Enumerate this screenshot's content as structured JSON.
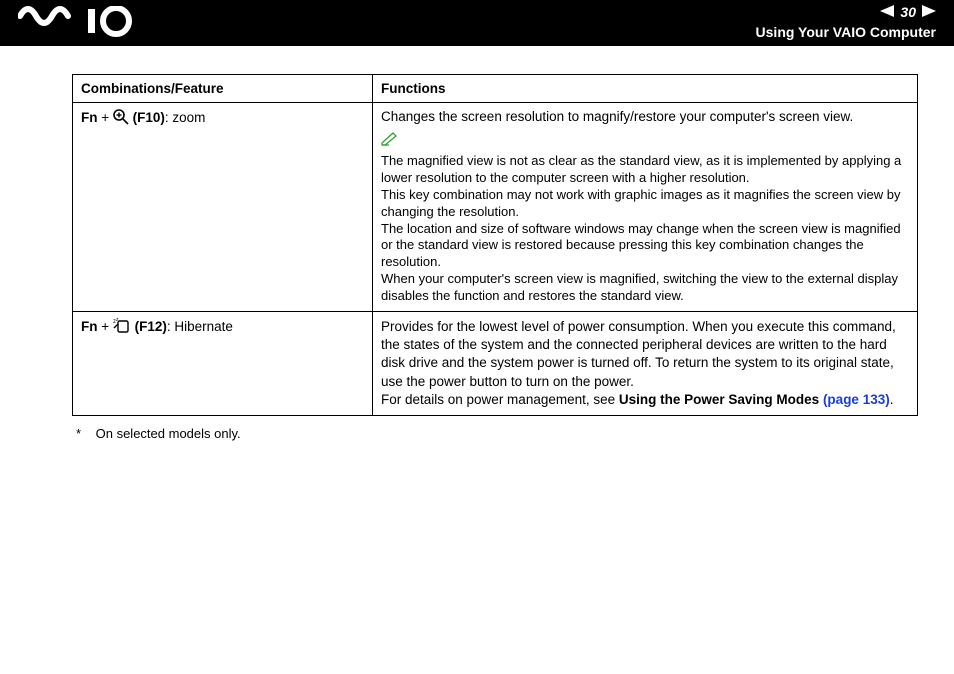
{
  "header": {
    "page_number": "30",
    "section_title": "Using Your VAIO Computer"
  },
  "table": {
    "head": {
      "combo": "Combinations/Feature",
      "func": "Functions"
    },
    "row_zoom": {
      "combo_prefix": "Fn",
      "combo_plus": " + ",
      "combo_key": " (F10)",
      "combo_suffix": ": zoom",
      "desc_main": "Changes the screen resolution to magnify/restore your computer's screen view.",
      "notes": {
        "n1": "The magnified view is not as clear as the standard view, as it is implemented by applying a lower resolution to the computer screen with a higher resolution.",
        "n2": "This key combination may not work with graphic images as it magnifies the screen view by changing the resolution.",
        "n3": "The location and size of software windows may change when the screen view is magnified or the standard view is restored because pressing this key combination changes the resolution.",
        "n4": "When your computer's screen view is magnified, switching the view to the external display disables the function and restores the standard view."
      }
    },
    "row_hib": {
      "combo_prefix": "Fn",
      "combo_plus": " + ",
      "combo_key": " (F12)",
      "combo_suffix": ": Hibernate",
      "desc_main": "Provides for the lowest level of power consumption. When you execute this command, the states of the system and the connected peripheral devices are written to the hard disk drive and the system power is turned off. To return the system to its original state, use the power button to turn on the power.",
      "ref_prefix": "For details on power management, see ",
      "ref_bold": "Using the Power Saving Modes ",
      "ref_link": "(page 133)",
      "ref_suffix": "."
    }
  },
  "footnote": {
    "star": "*",
    "text": "On selected models only."
  }
}
